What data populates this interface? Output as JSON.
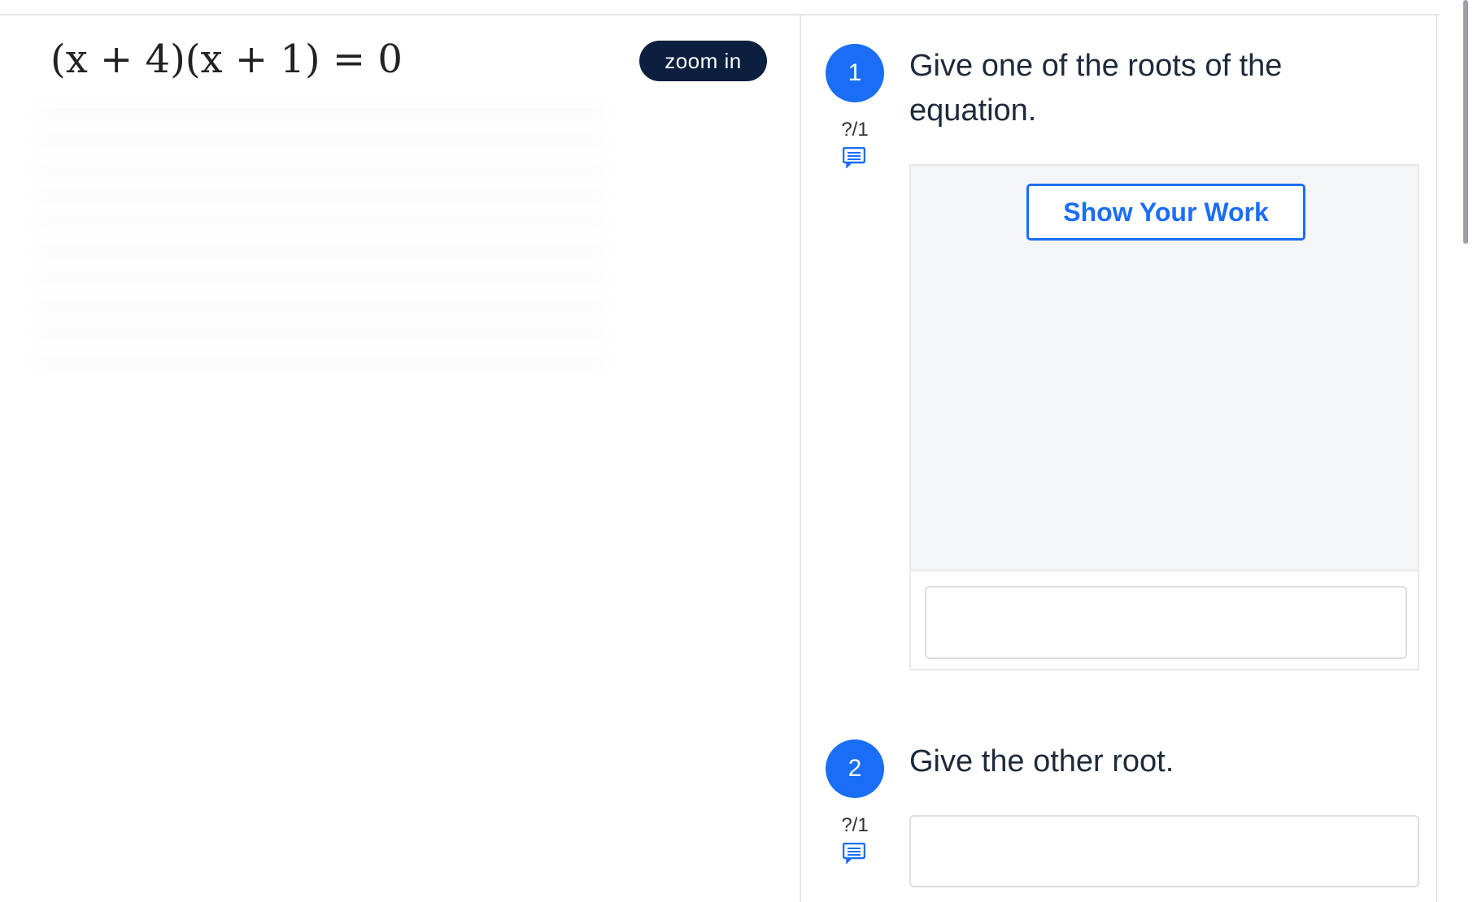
{
  "worksheet": {
    "equation": "(x + 4)(x + 1) = 0",
    "zoom_label": "zoom in"
  },
  "questions": [
    {
      "number": "1",
      "score": "?/1",
      "prompt": "Give one of the roots of the equation.",
      "show_work_label": "Show Your Work",
      "answer_value": ""
    },
    {
      "number": "2",
      "score": "?/1",
      "prompt": "Give the other root.",
      "answer_value": ""
    }
  ],
  "icons": {
    "comment": "comment-icon"
  },
  "colors": {
    "accent": "#1a6ef5",
    "zoom_button": "#0b1f3f",
    "panel_bg": "#f4f5f7"
  }
}
